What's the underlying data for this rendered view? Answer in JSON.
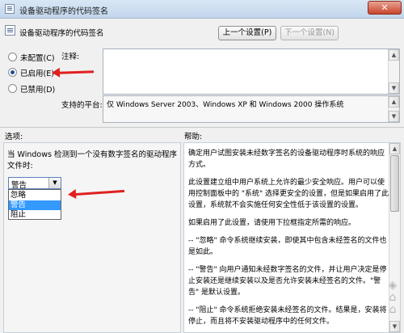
{
  "window": {
    "title": "设备驱动程序的代码签名",
    "close_label": "✕"
  },
  "header": {
    "policy_title": "设备驱动程序的代码签名",
    "prev_button": "上一个设置(P)",
    "next_button": "下一个设置(N)"
  },
  "state": {
    "options": [
      {
        "label": "未配置(C)",
        "checked": false
      },
      {
        "label": "已启用(E)",
        "checked": true
      },
      {
        "label": "已禁用(D)",
        "checked": false
      }
    ]
  },
  "comment": {
    "label": "注释:",
    "value": ""
  },
  "platform": {
    "label": "支持的平台:",
    "value": "仅 Windows Server 2003、Windows XP 和 Windows 2000 操作系统"
  },
  "sections": {
    "options_label": "选项:",
    "help_label": "帮助:"
  },
  "options_panel": {
    "prompt": "当 Windows 检测到一个没有数字签名的驱动程序文件时:",
    "selected": "警告",
    "dropdown_items": [
      "忽略",
      "警告",
      "阻止"
    ],
    "selected_index": 1
  },
  "help": {
    "paragraphs": [
      "确定用户试图安装未经数字签名的设备驱动程序时系统的响应方式。",
      "此设置建立组中用户系统上允许的最少安全响应。用户可以使用控制面板中的 \"系统\" 选择更安全的设置，但是如果启用了此设置，系统就不会实施任何安全性低于该设置的设置。",
      "如果启用了此设置，请使用下拉框指定所需的响应。",
      "-- \"忽略\" 命令系统继续安装，即使其中包含未经签名的文件也是如此。",
      "-- \"警告\" 向用户通知未经数字签名的文件，并让用户决定是停止安装还是继续安装以及是否允许安装未经签名的文件。\"警告\" 是默认设置。",
      "-- \"阻止\" 命令系统拒绝安装未经签名的文件。结果是，安装将停止，而且将不安装驱动程序中的任何文件。"
    ]
  },
  "icons": {
    "app": "policy-icon",
    "header": "policy-icon",
    "close": "close-icon",
    "combo_arrow": "chevron-down-icon"
  },
  "colors": {
    "accent": "#3399ff",
    "annotation_arrow": "#e02020",
    "close": "#c8442a"
  }
}
